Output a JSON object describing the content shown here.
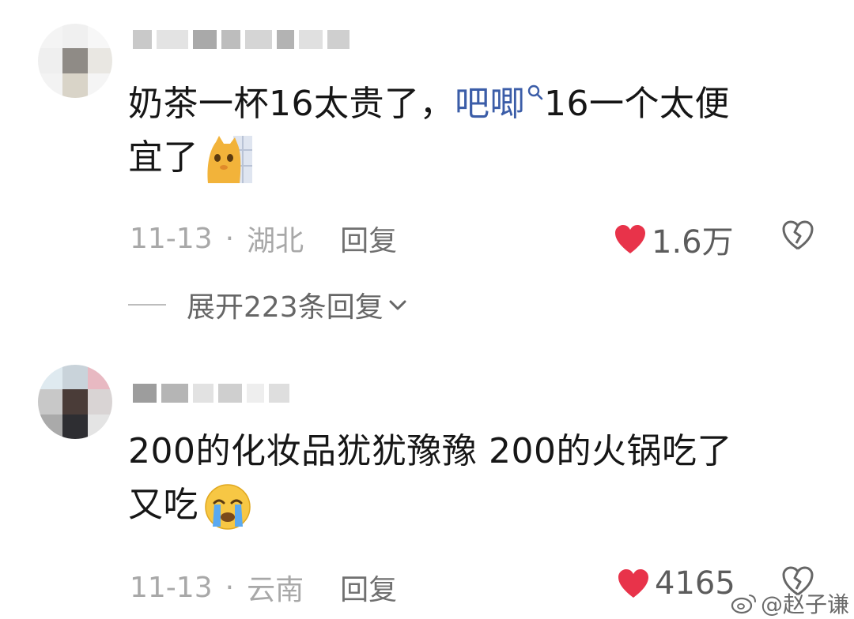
{
  "comments": [
    {
      "text_pre": "奶茶一杯16太贵了，",
      "link": "吧唧",
      "text_post": "16一个太便",
      "text_line2": "宜了",
      "date": "11-13",
      "region": "湖北",
      "reply_label": "回复",
      "likes": "1.6万",
      "expand_label": "展开223条回复"
    },
    {
      "text_line1": "200的化妆品犹犹豫豫 200的火锅吃了",
      "text_line2": "又吃",
      "date": "11-13",
      "region": "云南",
      "reply_label": "回复",
      "likes": "4165"
    }
  ],
  "watermark": "@赵子谦",
  "colors": {
    "like_heart": "#e8334a",
    "link": "#3b5da8"
  }
}
